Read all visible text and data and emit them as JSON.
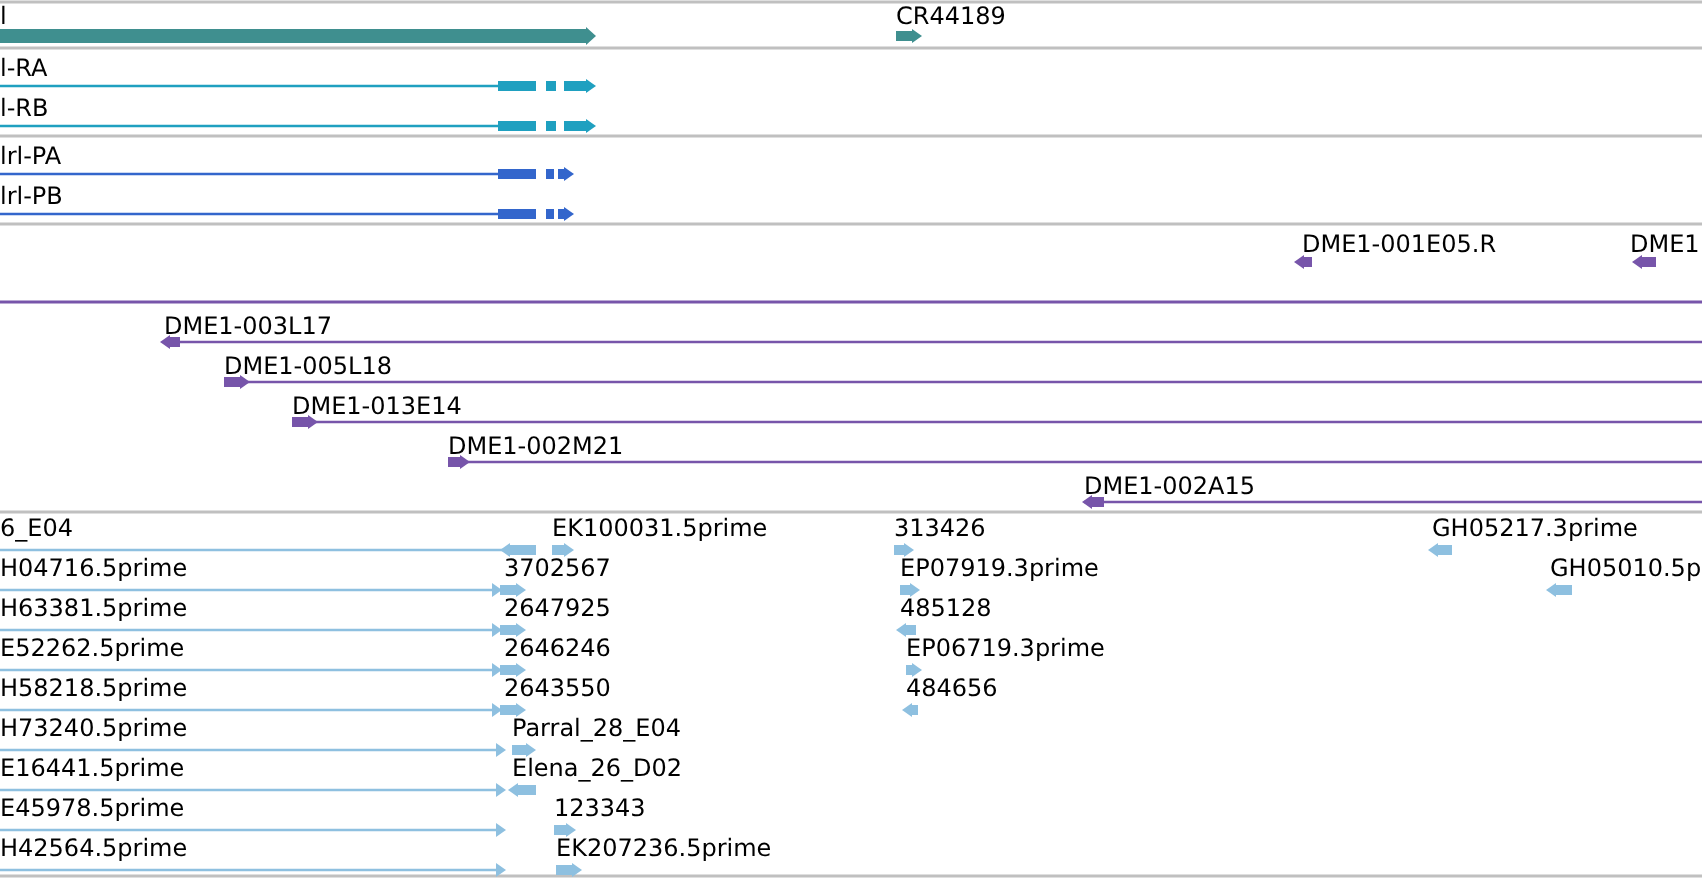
{
  "tracks": [
    {
      "color": "#3f8f8f",
      "features": [
        {
          "label": "l",
          "reverse": false
        },
        {
          "label": "CR44189",
          "reverse": false
        }
      ]
    },
    {
      "color": "#1fa0c0",
      "features": [
        {
          "label": "l-RA",
          "reverse": false
        },
        {
          "label": "l-RB",
          "reverse": false
        }
      ]
    },
    {
      "color": "#3366cc",
      "features": [
        {
          "label": "lrl-PA",
          "reverse": false
        },
        {
          "label": "lrl-PB",
          "reverse": false
        }
      ]
    },
    {
      "color": "#7755aa",
      "features": [
        {
          "label": "DME1-001E05.R",
          "reverse": true
        },
        {
          "label": "DME1",
          "reverse": true
        },
        {
          "label": "DME1-003L17",
          "reverse": true
        },
        {
          "label": "DME1-005L18",
          "reverse": false
        },
        {
          "label": "DME1-013E14",
          "reverse": false
        },
        {
          "label": "DME1-002M21",
          "reverse": false
        },
        {
          "label": "DME1-002A15",
          "reverse": true
        }
      ]
    },
    {
      "color": "#8ec0e0",
      "features": [
        {
          "label": "6_E04",
          "reverse": true
        },
        {
          "label": "EK100031.5prime",
          "reverse": false
        },
        {
          "label": "313426",
          "reverse": false
        },
        {
          "label": "GH05217.3prime",
          "reverse": true
        },
        {
          "label": "H04716.5prime",
          "reverse": false
        },
        {
          "label": "3702567",
          "reverse": false
        },
        {
          "label": "EP07919.3prime",
          "reverse": false
        },
        {
          "label": "GH05010.5p",
          "reverse": true
        },
        {
          "label": "H63381.5prime",
          "reverse": false
        },
        {
          "label": "2647925",
          "reverse": false
        },
        {
          "label": "485128",
          "reverse": true
        },
        {
          "label": "E52262.5prime",
          "reverse": false
        },
        {
          "label": "2646246",
          "reverse": false
        },
        {
          "label": "EP06719.3prime",
          "reverse": false
        },
        {
          "label": "H58218.5prime",
          "reverse": false
        },
        {
          "label": "2643550",
          "reverse": false
        },
        {
          "label": "484656",
          "reverse": true
        },
        {
          "label": "H73240.5prime",
          "reverse": false
        },
        {
          "label": "Parral_28_E04",
          "reverse": false
        },
        {
          "label": "E16441.5prime",
          "reverse": false
        },
        {
          "label": "Elena_26_D02",
          "reverse": true
        },
        {
          "label": "E45978.5prime",
          "reverse": false
        },
        {
          "label": "123343",
          "reverse": false
        },
        {
          "label": "H42564.5prime",
          "reverse": false
        },
        {
          "label": "EK207236.5prime",
          "reverse": false
        }
      ]
    }
  ]
}
